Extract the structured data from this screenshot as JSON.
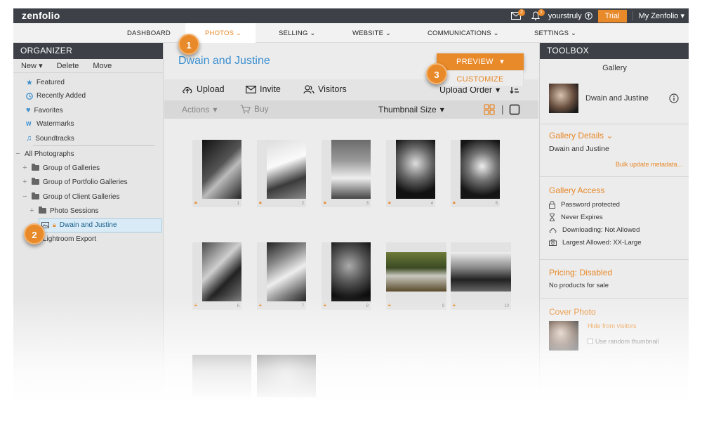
{
  "topbar": {
    "logo": "zenfolio",
    "messages_badge": "2",
    "notifications_badge": "1",
    "username": "yourstruly",
    "trial_label": "Trial",
    "my_zenfolio": "My Zenfolio"
  },
  "nav": {
    "dashboard": "DASHBOARD",
    "photos": "PHOTOS",
    "selling": "SELLING",
    "website": "WEBSITE",
    "communications": "COMMUNICATIONS",
    "settings": "SETTINGS"
  },
  "organizer": {
    "title": "ORGANIZER",
    "new": "New",
    "delete": "Delete",
    "move": "Move",
    "featured": "Featured",
    "recently_added": "Recently Added",
    "favorites": "Favorites",
    "watermarks": "Watermarks",
    "soundtracks": "Soundtracks",
    "all_photographs": "All Photographs",
    "group_galleries": "Group of Galleries",
    "group_portfolio": "Group of Portfolio Galleries",
    "group_client": "Group of Client Galleries",
    "photo_sessions": "Photo Sessions",
    "dwain_justine": "Dwain and Justine",
    "lightroom": "Lightroom Export"
  },
  "main": {
    "gallery_title": "Dwain and Justine",
    "upload": "Upload",
    "invite": "Invite",
    "visitors": "Visitors",
    "upload_order": "Upload Order",
    "actions": "Actions",
    "buy": "Buy",
    "thumbnail_size": "Thumbnail Size",
    "preview": "PREVIEW",
    "customize": "CUSTOMIZE",
    "thumbs": [
      {
        "num": "1"
      },
      {
        "num": "2"
      },
      {
        "num": "3"
      },
      {
        "num": "4"
      },
      {
        "num": "5"
      },
      {
        "num": "6"
      },
      {
        "num": "7"
      },
      {
        "num": "8"
      },
      {
        "num": "9"
      },
      {
        "num": "10"
      }
    ]
  },
  "toolbox": {
    "title": "TOOLBOX",
    "gallery_label": "Gallery",
    "gallery_name": "Dwain and Justine",
    "details_head": "Gallery Details",
    "details_name": "Dwain and Justine",
    "bulk_update": "Bulk update metadata...",
    "access_head": "Gallery Access",
    "password": "Password protected",
    "expires": "Never Expires",
    "downloading": "Downloading: Not Allowed",
    "largest": "Largest Allowed: XX-Large",
    "pricing_head": "Pricing: Disabled",
    "no_products": "No products for sale",
    "cover_head": "Cover Photo",
    "hide_visitors": "Hide from visitors",
    "random_thumb": "Use random thumbnail"
  },
  "callouts": {
    "one": "1",
    "two": "2",
    "three": "3"
  },
  "colors": {
    "accent": "#e8892a",
    "header": "#3d4147",
    "link": "#3a8fd0"
  }
}
